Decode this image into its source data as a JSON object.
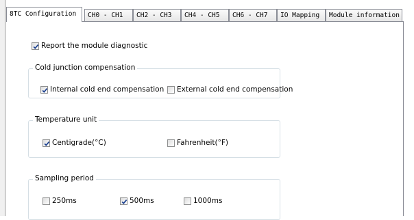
{
  "tabs": [
    {
      "label": "8TC Configuration",
      "active": true
    },
    {
      "label": "CH0 - CH1",
      "active": false
    },
    {
      "label": "CH2 - CH3",
      "active": false
    },
    {
      "label": "CH4 - CH5",
      "active": false
    },
    {
      "label": "CH6 - CH7",
      "active": false
    },
    {
      "label": "IO Mapping",
      "active": false
    },
    {
      "label": "Module information",
      "active": false
    }
  ],
  "diagnostic": {
    "label": "Report the module diagnostic",
    "checked": true
  },
  "cold_junction": {
    "title": "Cold junction compensation",
    "internal": {
      "label": "Internal cold end compensation",
      "checked": true
    },
    "external": {
      "label": "External cold end compensation",
      "checked": false
    }
  },
  "temperature_unit": {
    "title": "Temperature unit",
    "centigrade": {
      "label": "Centigrade(°C)",
      "checked": true
    },
    "fahrenheit": {
      "label": "Fahrenheit(°F)",
      "checked": false
    }
  },
  "sampling_period": {
    "title": "Sampling period",
    "options": [
      {
        "label": "250ms",
        "checked": false
      },
      {
        "label": "500ms",
        "checked": true
      },
      {
        "label": "1000ms",
        "checked": false
      }
    ]
  },
  "colors": {
    "check": "#1a3f8f",
    "border": "#898c95"
  }
}
